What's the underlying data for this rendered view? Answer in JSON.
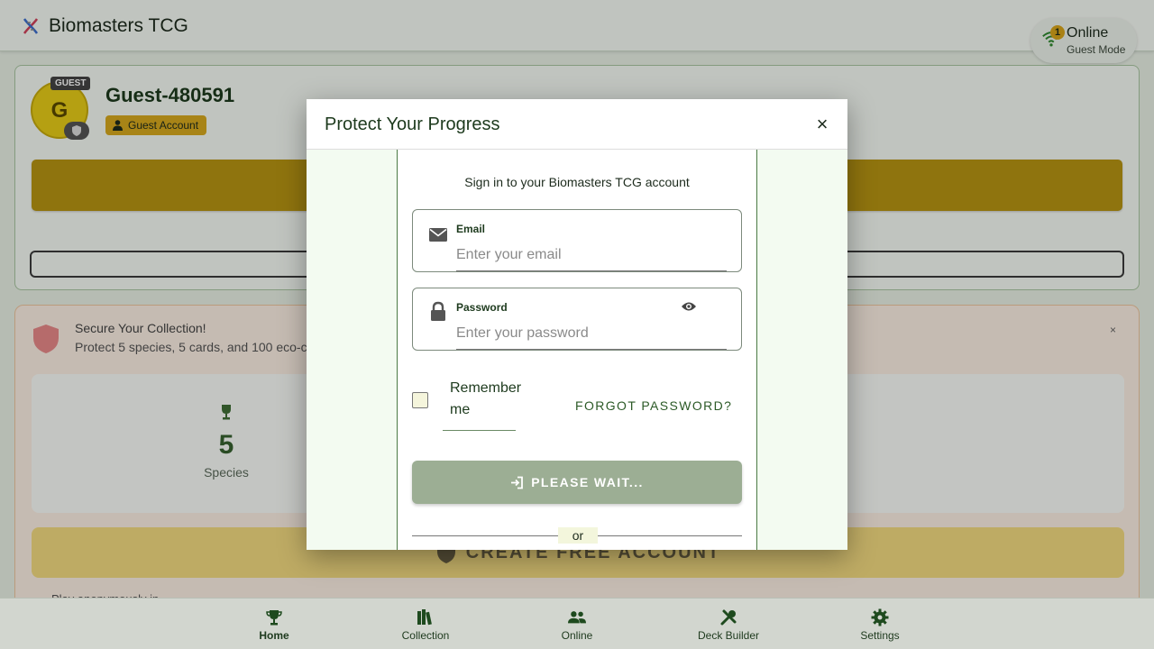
{
  "header": {
    "app_title": "Biomasters TCG",
    "logo_icon": "dna-icon",
    "connection": {
      "status": "Online",
      "mode": "Guest Mode",
      "notification_count": "1",
      "icon": "wifi-icon"
    }
  },
  "profile": {
    "avatar_letter": "G",
    "guest_tag": "GUEST",
    "username": "Guest-480591",
    "account_type": "Guest Account"
  },
  "secure_banner": {
    "title": "Secure Your Collection!",
    "description": "Protect 5 species, 5 cards, and 100 eco-c",
    "close_label": "×",
    "stats": [
      {
        "value": "5",
        "label": "Species",
        "icon": "trophy-icon"
      }
    ],
    "create_button_label": "CREATE FREE ACCOUNT",
    "footer_text": "Play anonymously in..."
  },
  "modal": {
    "title": "Protect Your Progress",
    "close_label": "×",
    "subtitle": "Sign in to your Biomasters TCG account",
    "email": {
      "label": "Email",
      "placeholder": "Enter your email",
      "icon": "envelope-icon"
    },
    "password": {
      "label": "Password",
      "placeholder": "Enter your password",
      "icon": "lock-icon"
    },
    "remember_label": "Remember me",
    "forgot_label": "FORGOT PASSWORD?",
    "submit_label": "PLEASE WAIT...",
    "divider_label": "or"
  },
  "bottom_nav": {
    "items": [
      {
        "label": "Home",
        "icon": "trophy-icon"
      },
      {
        "label": "Collection",
        "icon": "books-icon"
      },
      {
        "label": "Online",
        "icon": "users-icon"
      },
      {
        "label": "Deck Builder",
        "icon": "tools-icon"
      },
      {
        "label": "Settings",
        "icon": "gear-icon"
      }
    ]
  },
  "colors": {
    "primary": "#1d3a1d",
    "accent_gold": "#d8a91e",
    "avatar": "#e8ce18",
    "button_disabled": "#9cae94",
    "modal_body": "#f3fbf1"
  }
}
